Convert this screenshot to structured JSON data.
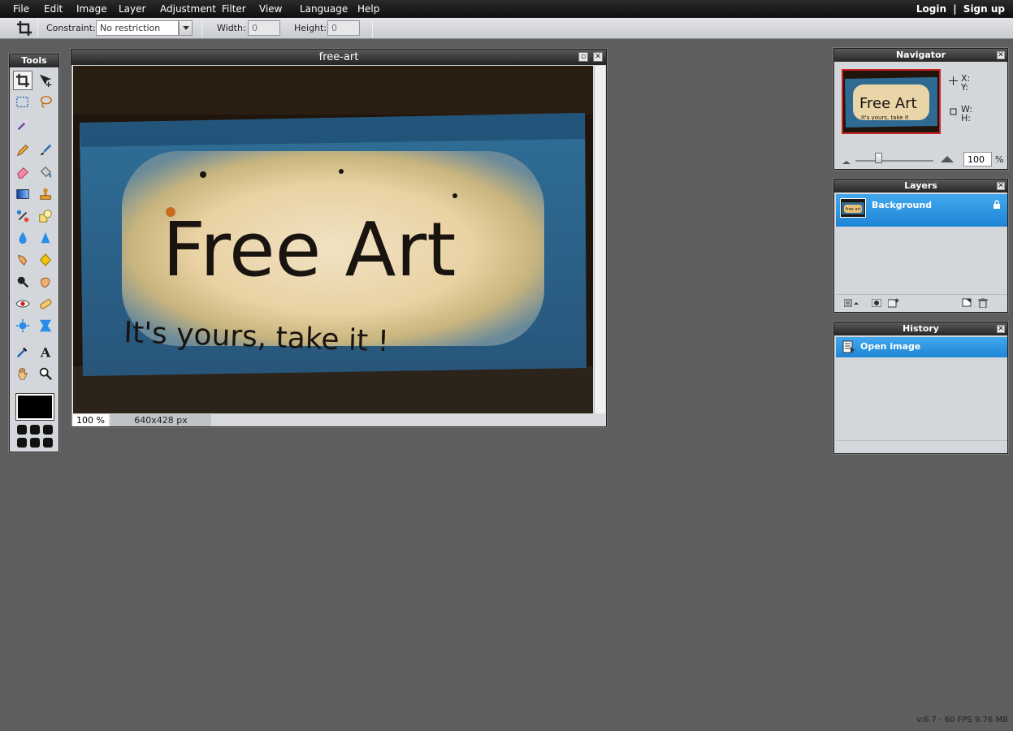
{
  "menu": {
    "items": [
      "File",
      "Edit",
      "Image",
      "Layer",
      "Adjustment",
      "Filter",
      "View",
      "Language",
      "Help"
    ],
    "login": "Login",
    "separator": "|",
    "signup": "Sign up"
  },
  "options": {
    "constraint_label": "Constraint:",
    "constraint_value": "No restriction",
    "width_label": "Width:",
    "width_value": "0",
    "height_label": "Height:",
    "height_value": "0"
  },
  "tools": {
    "title": "Tools",
    "items": [
      "crop-icon",
      "move-icon",
      "marquee-icon",
      "lasso-icon",
      "magic-wand-icon",
      "pencil-icon",
      "brush-icon",
      "eraser-icon",
      "bucket-icon",
      "gradient-icon",
      "clone-stamp-icon",
      "color-replace-icon",
      "shape-icon",
      "blur-icon",
      "sharpen-icon",
      "smudge-icon",
      "sponge-icon",
      "dodge-icon",
      "burn-icon",
      "red-eye-icon",
      "spot-heal-icon",
      "bloat-icon",
      "pinch-icon",
      "color-picker-icon",
      "text-icon",
      "hand-icon",
      "zoom-icon"
    ],
    "active": "crop-icon",
    "foreground_color": "#000000"
  },
  "document": {
    "title": "free-art",
    "zoom": "100 %",
    "size": "640x428 px",
    "image_text_main": "Free Art",
    "image_text_sub": "It's yours, take it !"
  },
  "navigator": {
    "title": "Navigator",
    "x_label": "X:",
    "y_label": "Y:",
    "w_label": "W:",
    "h_label": "H:",
    "zoom_value": "100",
    "zoom_unit": "%",
    "thumb_text_main": "Free Art",
    "thumb_text_sub": "It's yours, take it"
  },
  "layers": {
    "title": "Layers",
    "items": [
      {
        "name": "Background",
        "locked": true,
        "selected": true
      }
    ],
    "thumb_text": "free art"
  },
  "history": {
    "title": "History",
    "items": [
      {
        "label": "Open image",
        "selected": true
      }
    ]
  },
  "status": {
    "version": "v:6.7 - 60 FPS 9.76 MB"
  },
  "colors": {
    "menubar": "#1a1a1a",
    "selection": "#2b95e3",
    "workspace": "#5e5e5e",
    "panel": "#d3d6da"
  }
}
